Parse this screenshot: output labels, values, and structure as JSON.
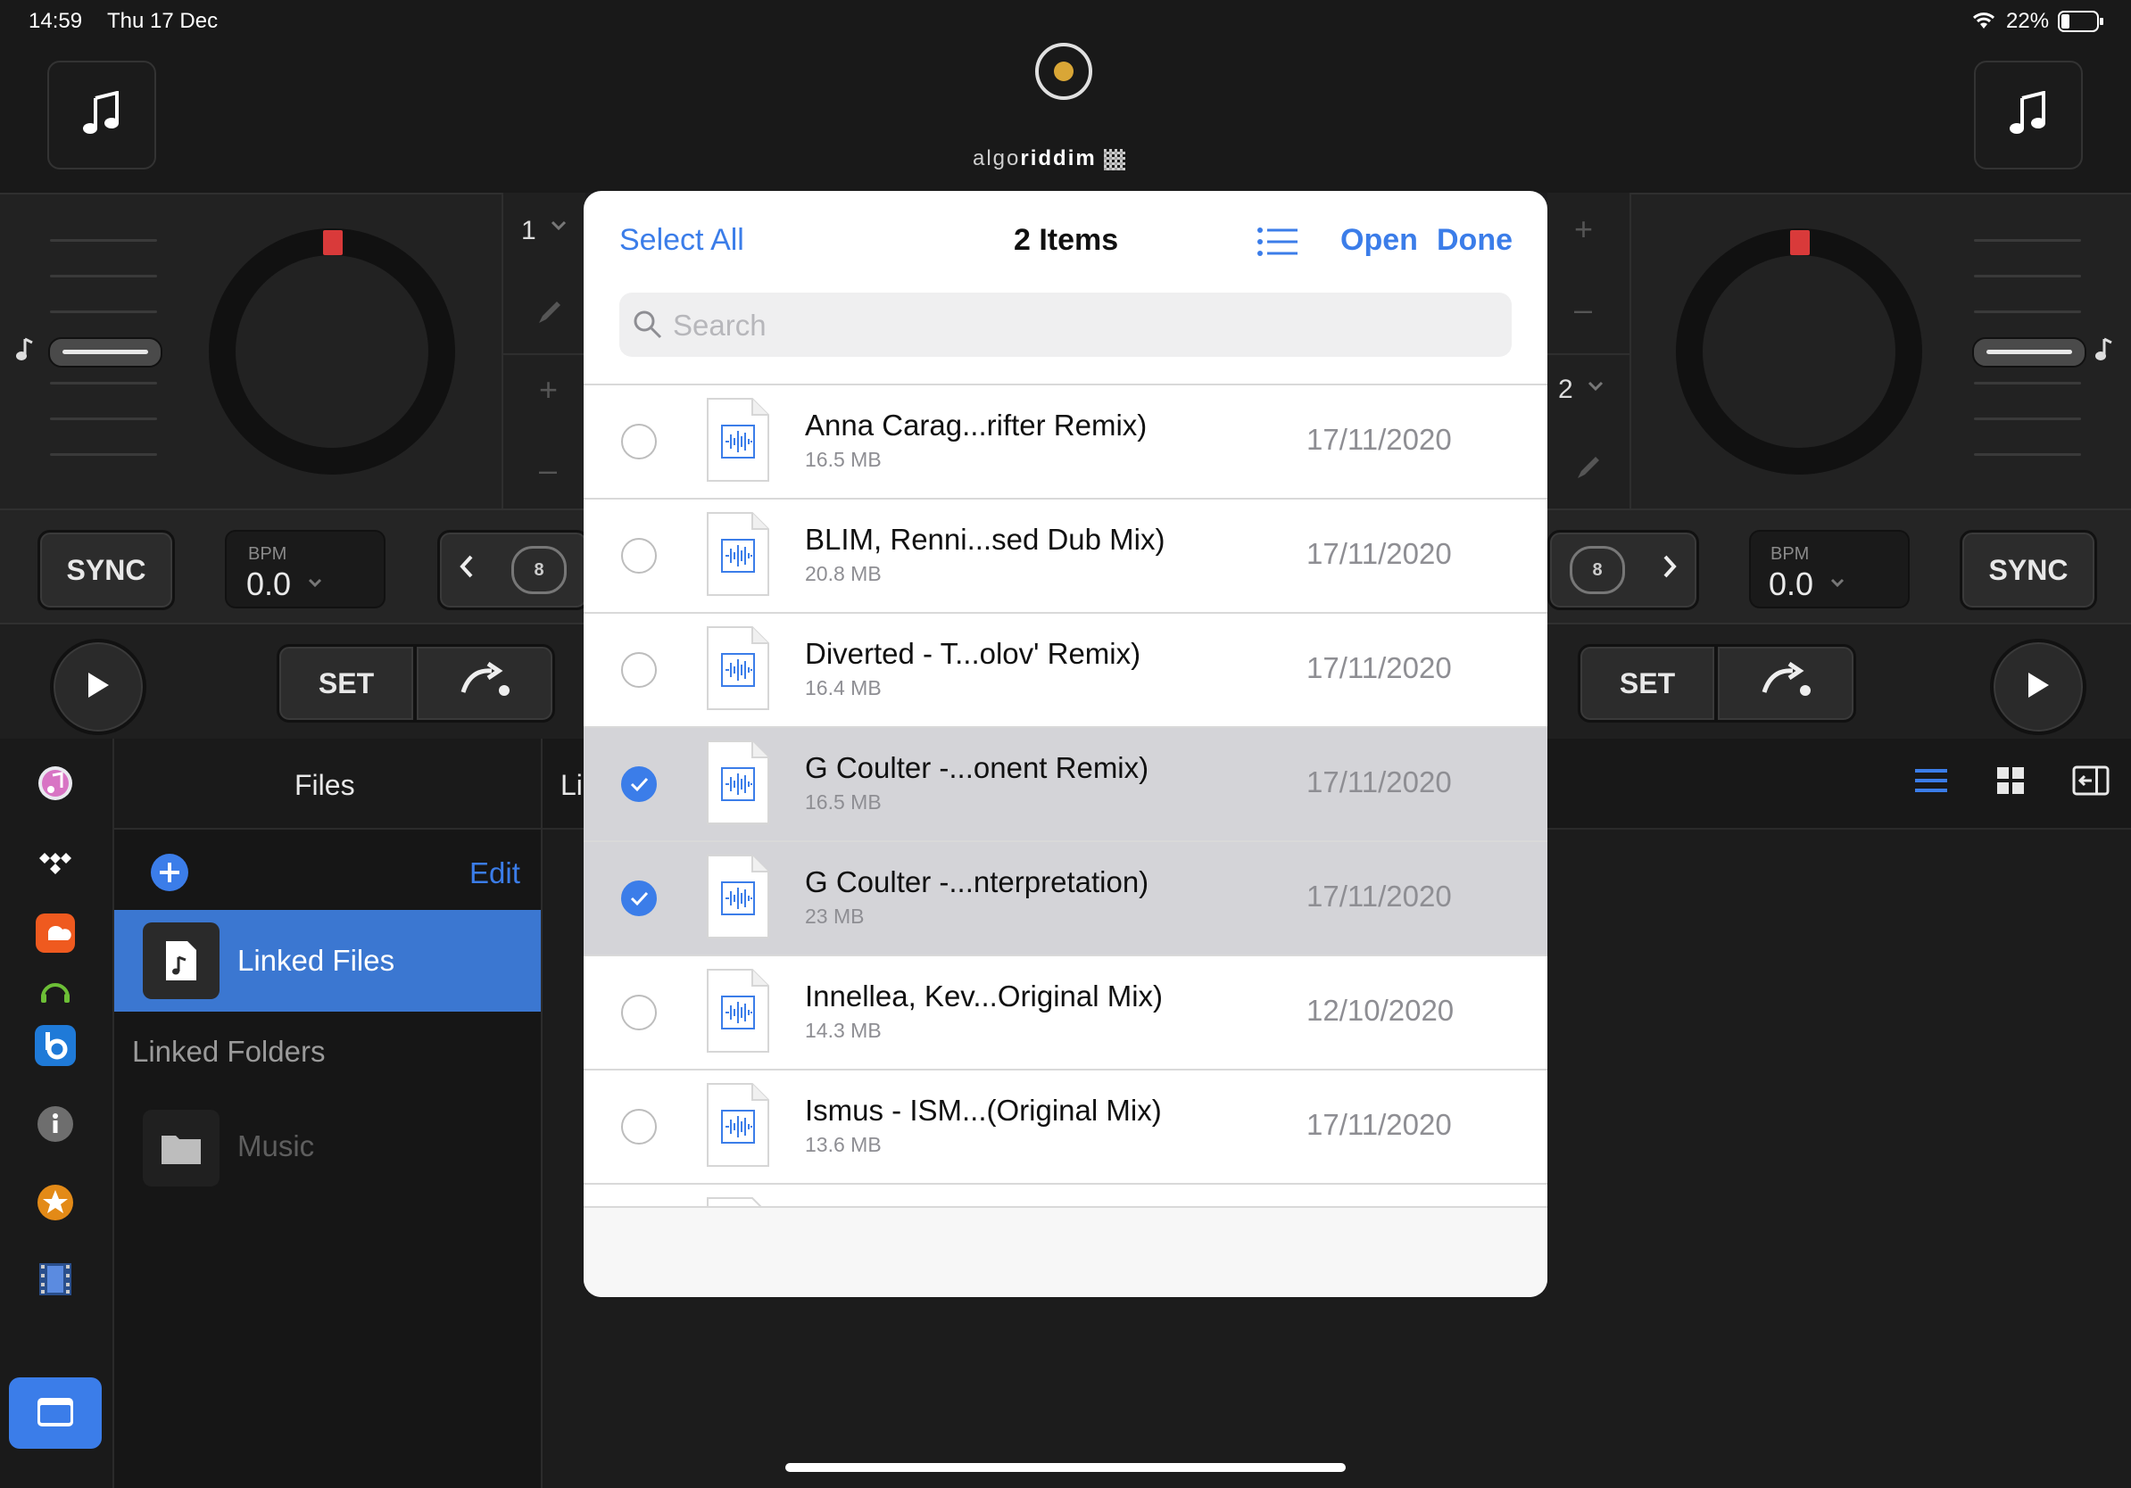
{
  "status_bar": {
    "time": "14:59",
    "date": "Thu 17 Dec",
    "battery": "22%"
  },
  "brand": {
    "logo_text_light": "algo",
    "logo_text_bold": "riddim"
  },
  "decks": {
    "left": {
      "sync_label": "SYNC",
      "bpm_label": "BPM",
      "bpm_value": "0.0",
      "loop_count": "8",
      "set_label": "SET",
      "deck_number": "1"
    },
    "right": {
      "sync_label": "SYNC",
      "bpm_label": "BPM",
      "bpm_value": "0.0",
      "loop_count": "8",
      "set_label": "SET",
      "deck_number": "2"
    }
  },
  "library": {
    "files_title": "Files",
    "edit_label": "Edit",
    "linked_files_label": "Linked Files",
    "linked_folders_heading": "Linked Folders",
    "music_folder_label": "Music",
    "list_header_partial": "Li"
  },
  "modal": {
    "select_all_label": "Select All",
    "title": "2 Items",
    "open_label": "Open",
    "done_label": "Done",
    "search_placeholder": "Search",
    "files": [
      {
        "name": "Anna Carag...rifter Remix)",
        "size": "16.5 MB",
        "date": "17/11/2020",
        "selected": false
      },
      {
        "name": "BLIM, Renni...sed Dub Mix)",
        "size": "20.8 MB",
        "date": "17/11/2020",
        "selected": false
      },
      {
        "name": "Diverted - T...olov' Remix)",
        "size": "16.4 MB",
        "date": "17/11/2020",
        "selected": false
      },
      {
        "name": "G Coulter -...onent Remix)",
        "size": "16.5 MB",
        "date": "17/11/2020",
        "selected": true
      },
      {
        "name": "G Coulter -...nterpretation)",
        "size": "23 MB",
        "date": "17/11/2020",
        "selected": true
      },
      {
        "name": "Innellea, Kev...Original Mix)",
        "size": "14.3 MB",
        "date": "12/10/2020",
        "selected": false
      },
      {
        "name": "Ismus - ISM...(Original Mix)",
        "size": "13.6 MB",
        "date": "17/11/2020",
        "selected": false
      }
    ]
  },
  "colors": {
    "accent": "#3b7de9",
    "selected_row": "#d4d4d8",
    "linked_files_bg": "#3b77d1",
    "platter_marker": "#d93a3a",
    "record_dot": "#d9a636"
  }
}
